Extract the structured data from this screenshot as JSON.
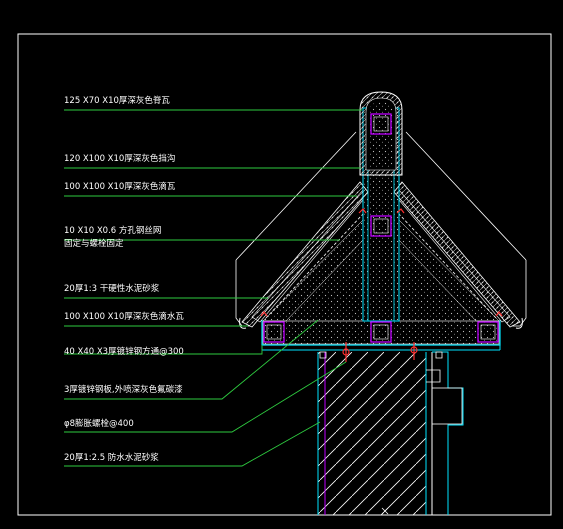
{
  "drawing": {
    "background": "#000000",
    "colors": {
      "frame": "#ffffff",
      "leader": "#2ecc40",
      "outline": "#00e5ff",
      "member": "#c000ff",
      "bolt": "#ff3030",
      "hatch": "#bfbfbf",
      "wall": "#ffffff"
    },
    "labels": [
      "125 X70 X10厚深灰色脊瓦",
      "120 X100 X10厚深灰色挡沟",
      "100 X100 X10厚深灰色滴瓦",
      "10 X10 X0.6 方孔钢丝网",
      "固定与螺栓固定",
      "20厚1:3 干硬性水泥砂浆",
      "100 X100 X10厚深灰色滴水瓦",
      "40 X40 X3厚镀锌钢方通@300",
      "3厚镀锌钢板,外喷深灰色氟碳漆",
      "φ8膨胀螺栓@400",
      "20厚1:2.5 防水水泥砂浆"
    ]
  }
}
